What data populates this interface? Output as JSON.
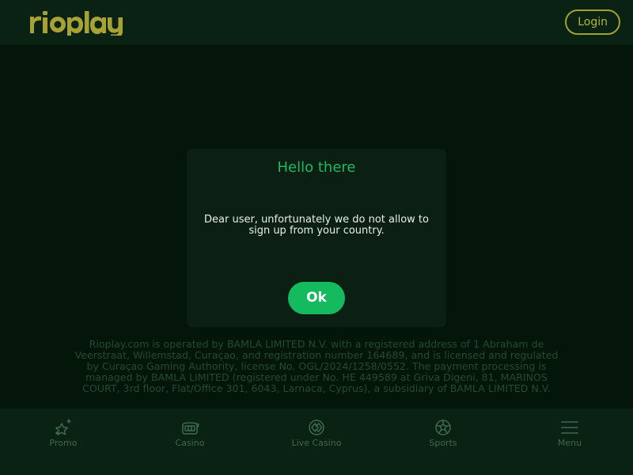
{
  "header": {
    "logo_text": "rioplay",
    "login_label": "Login"
  },
  "modal": {
    "title": "Hello there",
    "message": "Dear user, unfortunately we do not allow to sign up from your country.",
    "ok_label": "Ok"
  },
  "legal": {
    "text": "Rioplay.com is operated by BAMLA LIMITED N.V. with a registered address of 1 Abraham de Veerstraat, Willemstad, Curaçao, and registration number 164689, and is licensed and regulated by Curaçao Gaming Authority, license No. OGL/2024/1258/0552. The payment processing is managed by BAMLA LIMITED (registered under No. HE 449589 at Griva Digeni, 81, MARINOS COURT, 3rd floor, Flat/Office 301, 6043, Larnaca, Cyprus), a subsidiary of BAMLA LIMITED N.V."
  },
  "bottom_nav": {
    "items": [
      {
        "label": "Promo",
        "icon": "star-sparkle-icon"
      },
      {
        "label": "Casino",
        "icon": "slot-machine-icon"
      },
      {
        "label": "Live Casino",
        "icon": "cards-icon"
      },
      {
        "label": "Sports",
        "icon": "soccer-ball-icon"
      },
      {
        "label": "Menu",
        "icon": "hamburger-menu-icon"
      }
    ]
  },
  "colors": {
    "brand_logo": "#a8a235",
    "accent_green": "#16ba5e",
    "background": "#061a0c",
    "header_bg": "#092213",
    "nav_text": "#3f6a50"
  }
}
